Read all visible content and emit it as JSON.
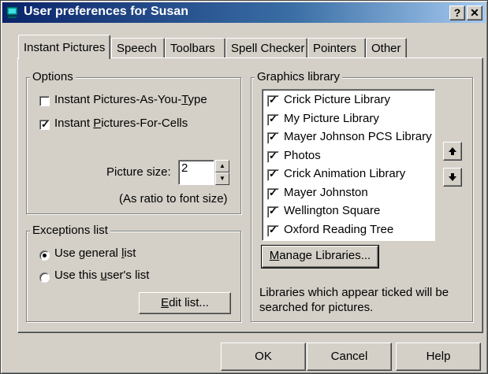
{
  "window": {
    "title": "User preferences for Susan",
    "help_button": "?",
    "close_button": "✕"
  },
  "tabs": [
    {
      "label": "Instant Pictures",
      "active": true
    },
    {
      "label": "Speech",
      "active": false
    },
    {
      "label": "Toolbars",
      "active": false
    },
    {
      "label": "Spell Checker",
      "active": false
    },
    {
      "label": "Pointers",
      "active": false
    },
    {
      "label": "Other",
      "active": false
    }
  ],
  "options": {
    "group_label": "Options",
    "as_you_type": {
      "label_pre": "Instant Pictures-As-You-",
      "label_u": "T",
      "label_post": "ype",
      "checked": false
    },
    "for_cells": {
      "label_pre": "Instant ",
      "label_u": "P",
      "label_post": "ictures-For-Cells",
      "checked": true
    },
    "picture_size_label": "Picture size:",
    "picture_size_value": "2",
    "ratio_note": "(As ratio to font size)"
  },
  "exceptions": {
    "group_label": "Exceptions list",
    "general": {
      "label_pre": "Use general ",
      "label_u": "l",
      "label_post": "ist",
      "selected": true
    },
    "user": {
      "label_pre": "Use this ",
      "label_u": "u",
      "label_post": "ser's list",
      "selected": false
    },
    "edit_button": {
      "label_u": "E",
      "label_post": "dit list..."
    }
  },
  "graphics": {
    "group_label": "Graphics library",
    "libraries": [
      {
        "name": "Crick Picture Library",
        "checked": true
      },
      {
        "name": "My Picture Library",
        "checked": true
      },
      {
        "name": "Mayer Johnson PCS Library",
        "checked": true
      },
      {
        "name": "Photos",
        "checked": true
      },
      {
        "name": "Crick Animation Library",
        "checked": true
      },
      {
        "name": "Mayer Johnston",
        "checked": true
      },
      {
        "name": "Wellington Square",
        "checked": true
      },
      {
        "name": "Oxford Reading Tree",
        "checked": true
      }
    ],
    "move_up_icon": "up-arrow",
    "move_down_icon": "down-arrow",
    "manage_button": {
      "label_u": "M",
      "label_post": "anage Libraries..."
    },
    "note": "Libraries which appear ticked will be searched for pictures."
  },
  "footer": {
    "ok": "OK",
    "cancel": "Cancel",
    "help": "Help"
  }
}
